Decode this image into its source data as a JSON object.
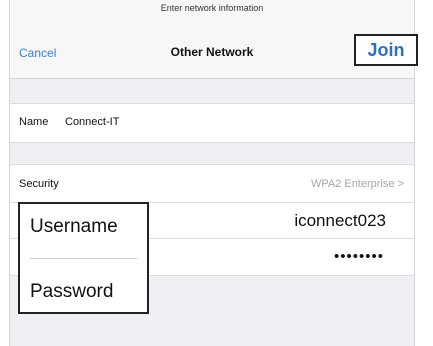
{
  "header": {
    "prompt": "Enter network information",
    "cancel_label": "Cancel",
    "title": "Other Network",
    "join_label": "Join"
  },
  "fields": {
    "name_label": "Name",
    "name_value": "Connect-IT",
    "security_label": "Security",
    "security_value": "WPA2 Enterprise",
    "security_chevron": ">",
    "username_label": "Username",
    "username_value": "iconnect023",
    "password_label": "Password",
    "password_value": "••••••••"
  },
  "icons": {
    "chevron": "chevron-right-icon"
  },
  "colors": {
    "accent": "#3b7fd6",
    "join": "#2f6fc2",
    "group_background": "#efeff4",
    "secondary_text": "#a6a6ab"
  }
}
